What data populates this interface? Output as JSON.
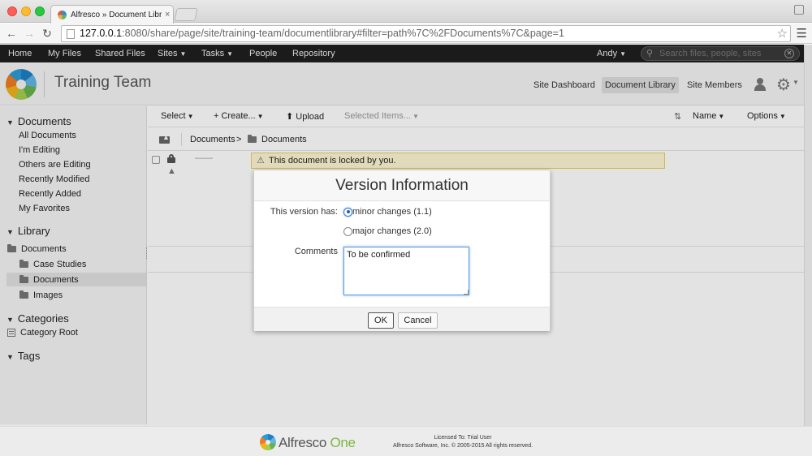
{
  "browser": {
    "tab_title": "Alfresco » Document Libra",
    "tab_close": "×",
    "url_host": "127.0.0.1",
    "url_rest": ":8080/share/page/site/training-team/documentlibrary#filter=path%7C%2FDocuments%7C&page=1"
  },
  "appnav": {
    "items": [
      "Home",
      "My Files",
      "Shared Files",
      "Sites",
      "Tasks",
      "People",
      "Repository"
    ],
    "user": "Andy",
    "search_placeholder": "Search files, people, sites"
  },
  "site": {
    "title": "Training Team",
    "links": [
      "Site Dashboard",
      "Document Library",
      "Site Members"
    ],
    "active_link": "Document Library"
  },
  "sidebar": {
    "documents_heading": "Documents",
    "document_filters": [
      "All Documents",
      "I'm Editing",
      "Others are Editing",
      "Recently Modified",
      "Recently Added",
      "My Favorites"
    ],
    "library_heading": "Library",
    "library_root": "Documents",
    "library_children": [
      "Case Studies",
      "Documents",
      "Images"
    ],
    "categories_heading": "Categories",
    "category_root": "Category Root",
    "tags_heading": "Tags"
  },
  "toolbar": {
    "select": "Select",
    "create": "Create...",
    "upload": "Upload",
    "selected_items": "Selected Items...",
    "sort": "Name",
    "options": "Options"
  },
  "breadcrumb": {
    "root": "Documents",
    "sep": ">",
    "current": "Documents"
  },
  "document_row": {
    "placeholder": "——",
    "lock_message": "This document is locked by you."
  },
  "dialog": {
    "title": "Version Information",
    "version_label": "This version has:",
    "minor_option": "minor changes (1.1)",
    "major_option": "major changes (2.0)",
    "selected_option": "minor",
    "comments_label": "Comments",
    "comments_value": "To be confirmed",
    "ok": "OK",
    "cancel": "Cancel"
  },
  "footer": {
    "brand": "Alfresco",
    "brand_suffix": "One",
    "license_line1": "Licensed To: Trial User",
    "license_line2": "Alfresco Software, Inc. © 2005-2015 All rights reserved."
  },
  "colors": {
    "nav_bg": "#1f1f1f",
    "lock_banner_bg": "#fdf6d2",
    "brand_green": "#7db641",
    "focus_blue": "#5a9ad8"
  }
}
